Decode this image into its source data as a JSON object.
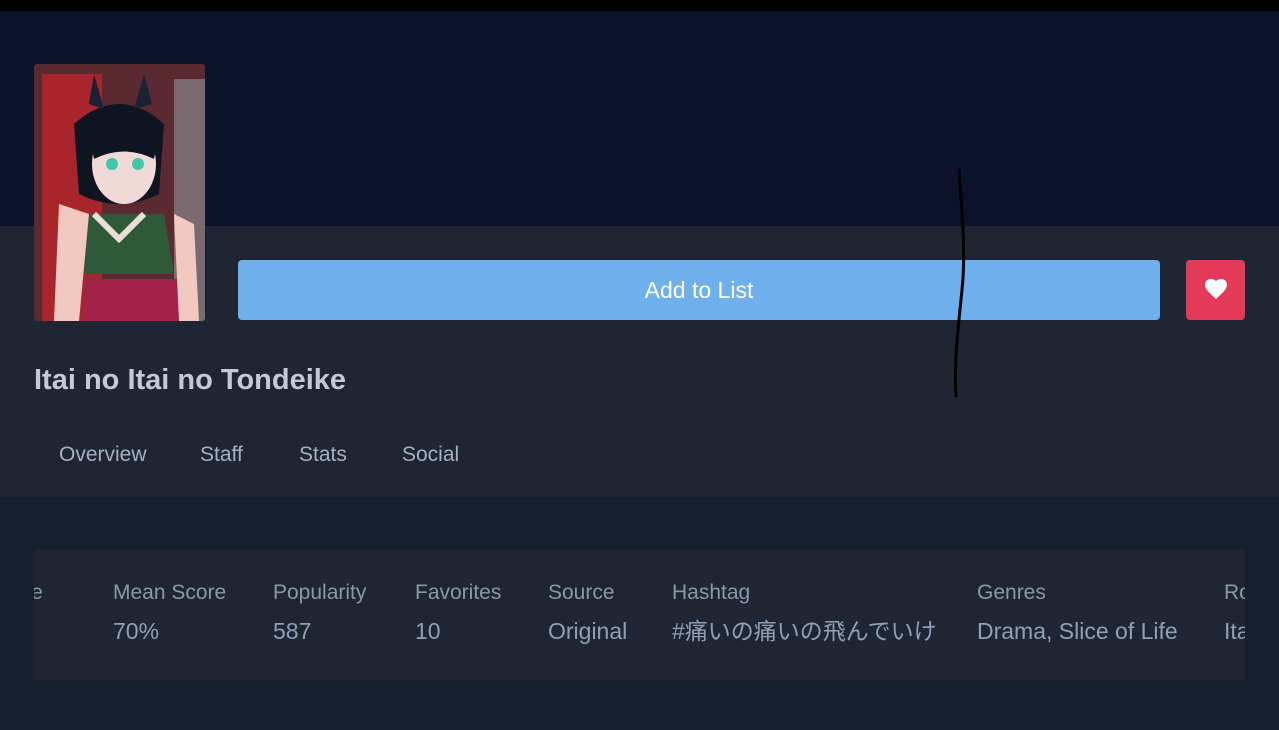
{
  "media": {
    "title": "Itai no Itai no Tondeike",
    "cover_alt": "Itai no Itai no Tondeike cover art"
  },
  "actions": {
    "add_to_list_label": "Add to List",
    "favorite_icon": "heart-icon"
  },
  "tabs": [
    {
      "label": "Overview"
    },
    {
      "label": "Staff"
    },
    {
      "label": "Stats"
    },
    {
      "label": "Social"
    }
  ],
  "stats": [
    {
      "label": "Score",
      "value": ""
    },
    {
      "label": "Mean Score",
      "value": "70%"
    },
    {
      "label": "Popularity",
      "value": "587"
    },
    {
      "label": "Favorites",
      "value": "10"
    },
    {
      "label": "Source",
      "value": "Original"
    },
    {
      "label": "Hashtag",
      "value": "#痛いの痛いの飛んでいけ"
    },
    {
      "label": "Genres",
      "value": "Drama, Slice of Life"
    },
    {
      "label": "Ro",
      "value": "Ita"
    }
  ],
  "colors": {
    "accent_blue": "#6db0eb",
    "favorite_red": "#e43a5a",
    "banner_bg": "#0b1229",
    "header_bg": "#1f2533",
    "page_bg": "#151f2e"
  }
}
